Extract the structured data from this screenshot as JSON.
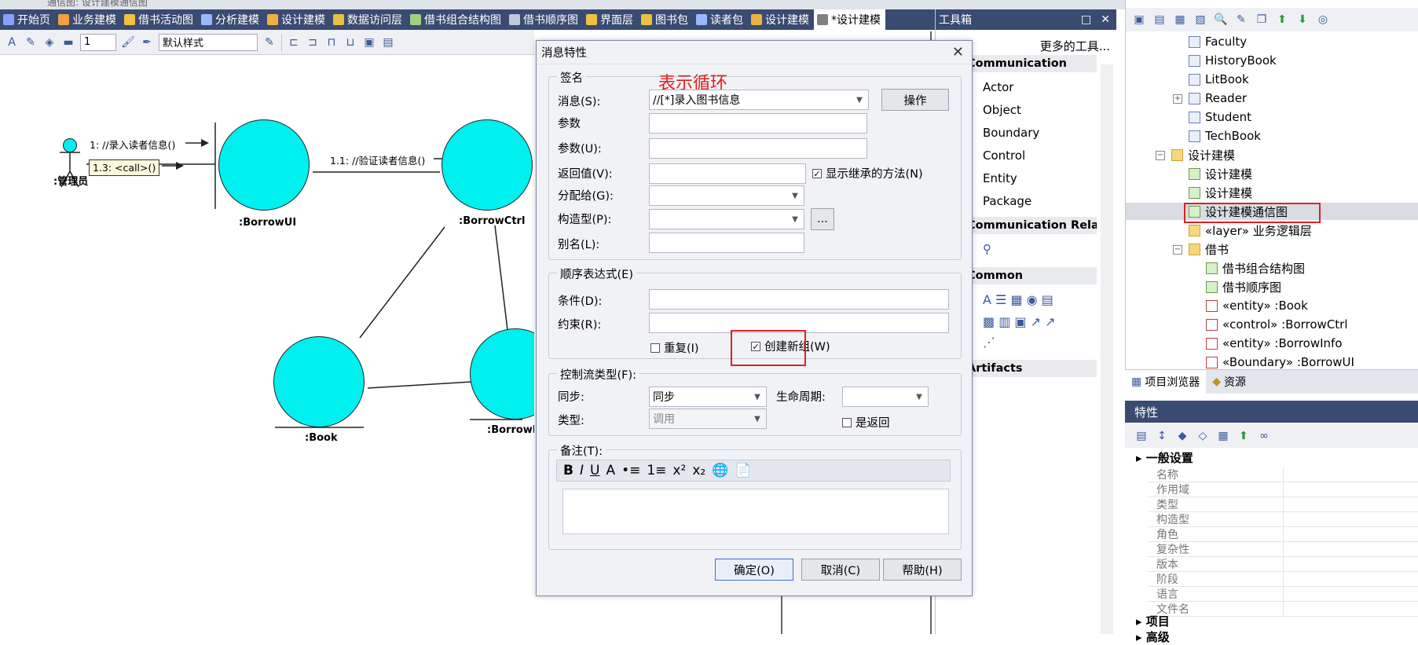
{
  "window": {
    "title_fragment": "通信图: 设计建模通信图",
    "tabs": [
      {
        "label": "开始页",
        "color": "#8aa0ff",
        "active": false
      },
      {
        "label": "业务建模",
        "color": "#f0a040",
        "active": false
      },
      {
        "label": "借书活动图",
        "color": "#f0c040",
        "active": false
      },
      {
        "label": "分析建模",
        "color": "#9ab8ff",
        "active": false
      },
      {
        "label": "设计建模",
        "color": "#f0b040",
        "active": false
      },
      {
        "label": "数据访问层",
        "color": "#e8c040",
        "active": false
      },
      {
        "label": "借书组合结构图",
        "color": "#a0d080",
        "active": false
      },
      {
        "label": "借书顺序图",
        "color": "#c0c8e0",
        "active": false
      },
      {
        "label": "界面层",
        "color": "#f0c040",
        "active": false
      },
      {
        "label": "图书包",
        "color": "#f0c040",
        "active": false
      },
      {
        "label": "读者包",
        "color": "#9ab8ff",
        "active": false
      },
      {
        "label": "设计建模",
        "color": "#f0b040",
        "active": false
      },
      {
        "label": "*设计建模",
        "color": "#808080",
        "active": true
      }
    ]
  },
  "diagram_toolbar": {
    "line_width_value": "1",
    "style_select": "默认样式"
  },
  "diagram": {
    "actor_label": ":管理员",
    "msg_1": "1: //录入读者信息()",
    "msg_1_3": "1.3: <call>()",
    "msg_1_1": "1.1: //验证读者信息()",
    "nodes": [
      ":BorrowUI",
      ":BorrowCtrl",
      ":Book",
      ":BorrowInfo"
    ]
  },
  "toolbox": {
    "title": "工具箱",
    "more_tools": "更多的工具...",
    "sections": [
      "Communication",
      "Communication Relationships",
      "Common",
      "Artifacts"
    ],
    "items": [
      "Actor",
      "Object",
      "Boundary",
      "Control",
      "Entity",
      "Package"
    ]
  },
  "project_browser": {
    "title": "项目浏览器",
    "tree": [
      "Faculty",
      "HistoryBook",
      "LitBook",
      "Reader",
      "Student",
      "TechBook",
      "设计建模",
      "设计建模",
      "设计建模",
      "设计建模通信图",
      "«layer» 业务逻辑层",
      "借书",
      "借书组合结构图",
      "借书顺序图",
      "«entity» :Book",
      "«control» :BorrowCtrl",
      "«entity» :BorrowInfo",
      "«Boundary» :BorrowUI"
    ],
    "tabs": [
      "项目浏览器",
      "资源"
    ]
  },
  "properties": {
    "title": "特性",
    "group_general": "一般设置",
    "rows": [
      "名称",
      "作用域",
      "类型",
      "构造型",
      "角色",
      "复杂性",
      "版本",
      "阶段",
      "语言",
      "文件名"
    ],
    "group_project": "项目",
    "group_advanced": "高级"
  },
  "dialog": {
    "title": "消息特性",
    "annotation": "表示循环",
    "signature": {
      "group": "签名",
      "message_label": "消息(S):",
      "message_value": "//[*]录入图书信息",
      "operation_btn": "操作",
      "param1_label": "参数",
      "param2_label": "参数(U):",
      "return_label": "返回值(V):",
      "show_inherited": "显示继承的方法(N)",
      "assign_label": "分配给(G):",
      "stereotype_label": "构造型(P):",
      "stereotype_btn": "...",
      "alias_label": "别名(L):"
    },
    "sequence": {
      "group": "顺序表达式(E)",
      "condition_label": "条件(D):",
      "constraint_label": "约束(R):",
      "repeat_label": "重复(I)",
      "new_group_label": "创建新组(W)"
    },
    "control_flow": {
      "group": "控制流类型(F):",
      "sync_label": "同步:",
      "sync_value": "同步",
      "lifecycle_label": "生命周期:",
      "type_label": "类型:",
      "type_value": "调用",
      "is_return_label": "是返回"
    },
    "notes": {
      "group": "备注(T):",
      "rich_buttons": [
        "B",
        "I",
        "U",
        "A",
        "•≡",
        "1≡",
        "x²",
        "x₂",
        "🌐",
        "📄"
      ]
    },
    "buttons": {
      "ok": "确定(O)",
      "cancel": "取消(C)",
      "help": "帮助(H)"
    }
  },
  "colors": {
    "tabbar": "#3a4b72",
    "node_fill": "#00f0f0",
    "annotation": "#e02020"
  }
}
